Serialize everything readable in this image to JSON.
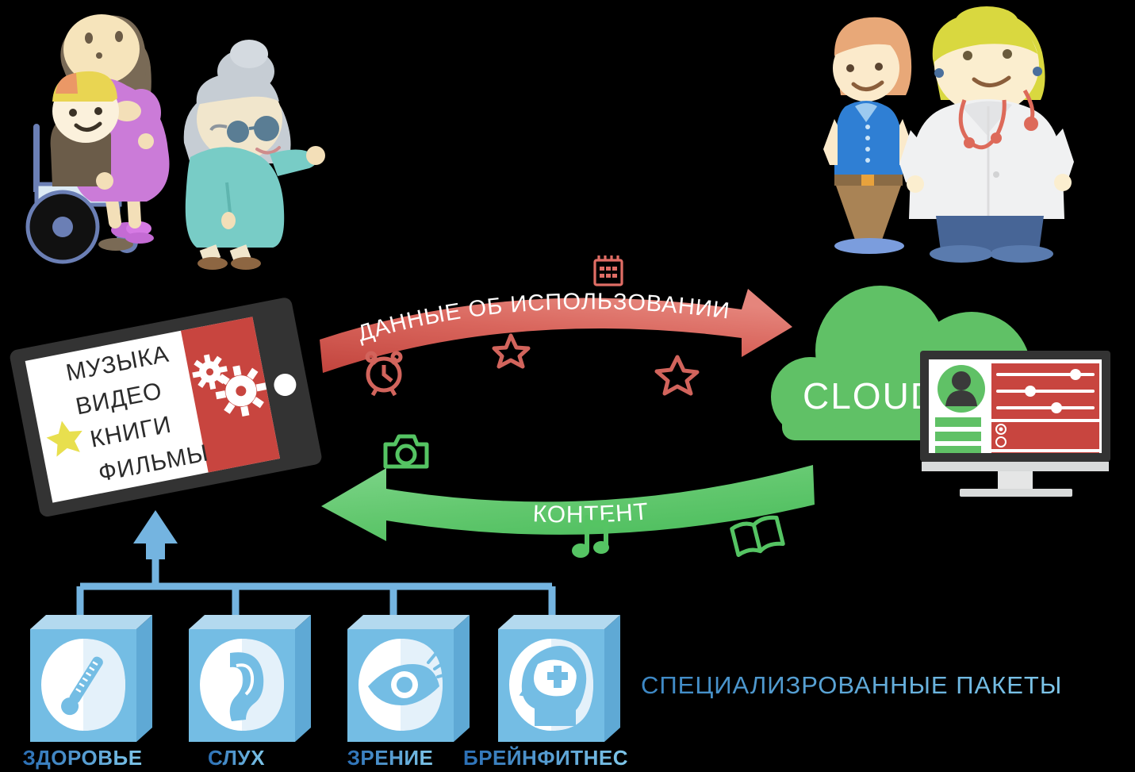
{
  "diagram": {
    "title_hidden": "",
    "colors": {
      "red_arrow": "#cd4c45",
      "red_arrow_light": "#e07b72",
      "green_arrow": "#62c86e",
      "green_arrow_light": "#86d88e",
      "cloud_green": "#60c166",
      "box_blue": "#74bde4",
      "box_blue_top": "#b3d9ef",
      "box_blue_side": "#5fa9d5",
      "label_blue_dark": "#2b6fb5",
      "label_blue_light": "#7fc7ea",
      "tablet_dark": "#333333",
      "screen_white": "#ffffff",
      "screen_red": "#c8453f",
      "star_yellow": "#e8df4e",
      "line_blue": "#74b4e0",
      "monitor_dark": "#333333",
      "monitor_stand": "#d8dada"
    }
  },
  "tablet": {
    "menu_items": [
      "МУЗЫКА",
      "ВИДЕО",
      "КНИГИ",
      "ФИЛЬМЫ"
    ],
    "star_icon": "star-icon",
    "gears_icon": "gears-icon",
    "camera_dot": "camera-dot"
  },
  "arrows": {
    "upper": {
      "label": "ДАННЫЕ ОБ ИСПОЛЬЗОВАНИИ",
      "direction": "right",
      "color": "#cd4c45",
      "decor_icons": [
        "calendar-icon",
        "alarm-clock-icon",
        "star-small-icon",
        "star-outline-icon"
      ]
    },
    "lower": {
      "label": "КОНТЕНТ",
      "direction": "left",
      "color": "#62c86e",
      "decor_icons": [
        "camera-icon",
        "music-note-icon",
        "open-book-icon"
      ]
    }
  },
  "cloud": {
    "label": "CLOUD",
    "color": "#60c166"
  },
  "monitor": {
    "avatar_icon": "user-avatar-icon",
    "sliders": [
      {
        "name": "slider-1",
        "value": 82
      },
      {
        "name": "slider-2",
        "value": 34
      },
      {
        "name": "slider-3",
        "value": 62
      }
    ],
    "green_bars": 3,
    "radio_groups": [
      {
        "options": [
          "selected",
          "unselected"
        ]
      },
      {
        "options": [
          "unselected"
        ]
      }
    ]
  },
  "packages": {
    "section_label": "СПЕЦИАЛИЗРОВАННЫЕ ПАКЕТЫ",
    "items": [
      {
        "label": "ЗДОРОВЬЕ",
        "icon": "thermometer-icon"
      },
      {
        "label": "СЛУХ",
        "icon": "ear-icon"
      },
      {
        "label": "ЗРЕНИЕ",
        "icon": "eye-icon"
      },
      {
        "label": "БРЕЙНФИТНЕС",
        "icon": "head-brain-puzzle-icon"
      }
    ]
  },
  "people": {
    "left_group": [
      "woman-purple-dress",
      "child-yellow-cap",
      "wheelchair",
      "elderly-woman-sunglasses"
    ],
    "right_group": [
      "young-man-blue-shirt",
      "doctor-white-coat-stethoscope"
    ]
  }
}
